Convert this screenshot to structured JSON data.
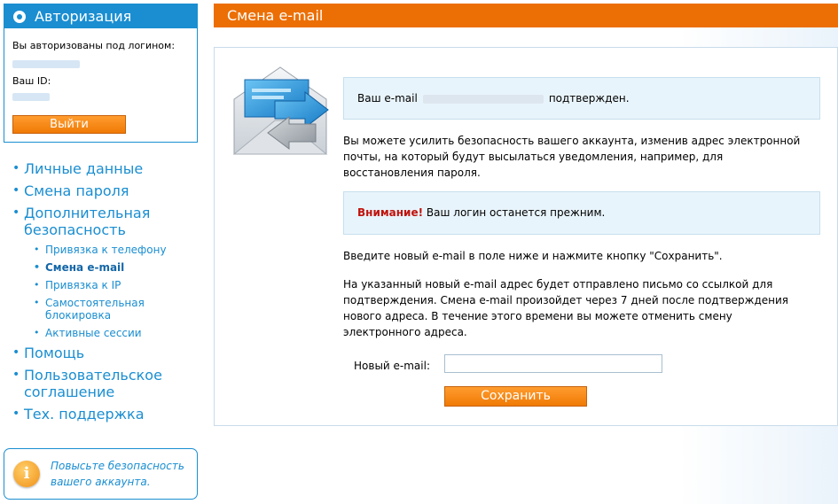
{
  "auth": {
    "title": "Авторизация",
    "logged_in_label": "Вы авторизованы под логином:",
    "id_label": "Ваш ID:",
    "logout_label": "Выйти"
  },
  "nav": {
    "personal": "Личные данные",
    "change_password": "Смена пароля",
    "extra_security": "Дополнительная безопасность",
    "sub": {
      "phone": "Привязка к телефону",
      "email": "Смена e-mail",
      "ip": "Привязка к IP",
      "self_block": "Самостоятельная блокировка",
      "sessions": "Активные сессии"
    },
    "help": "Помощь",
    "agreement": "Пользовательское соглашение",
    "support": "Тех. поддержка"
  },
  "tip": {
    "icon": "info-icon",
    "text": "Повысьте безопасность вашего аккаунта."
  },
  "main": {
    "title": "Смена e-mail",
    "confirm_prefix": "Ваш e-mail",
    "confirm_suffix": "подтвержден.",
    "paragraph1": "Вы можете усилить безопасность вашего аккаунта, изменив адрес электронной почты, на который будут высылаться уведомления, например, для восстановления пароля.",
    "warning_label": "Внимание!",
    "warning_text": "Ваш логин останется прежним.",
    "paragraph2": "Введите новый e-mail в поле ниже и нажмите кнопку \"Сохранить\".",
    "paragraph3": "На указанный новый e-mail адрес будет отправлено письмо со ссылкой для подтверждения. Смена e-mail произойдет через 7 дней после подтверждения нового адреса. В течение этого времени вы можете отменить смену электронного адреса.",
    "field_label": "Новый e-mail:",
    "field_value": "",
    "save_label": "Сохранить"
  },
  "colors": {
    "accent_blue": "#1a8ed1",
    "accent_orange": "#ec6f05",
    "warning_red": "#c0120c"
  }
}
